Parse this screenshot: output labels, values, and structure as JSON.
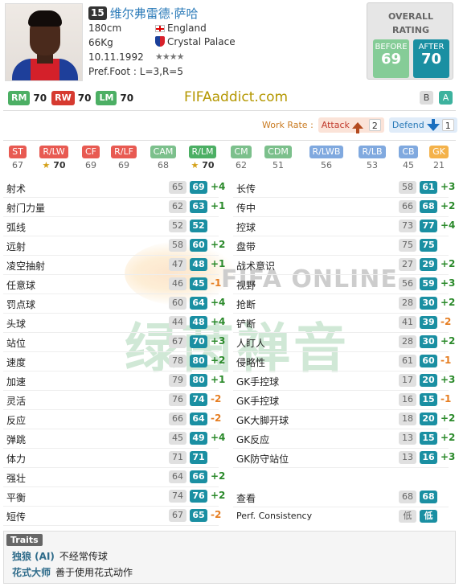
{
  "player": {
    "season_badge": "15",
    "name": "维尔弗雷德·萨哈",
    "height": "180cm",
    "weight": "66Kg",
    "birthdate": "10.11.1992",
    "nation": "England",
    "club": "Crystal Palace",
    "stars": "★★★★",
    "pref_foot": "Pref.Foot : L=3,R=5"
  },
  "overall": {
    "label": "OVERALL RATING",
    "before_label": "BEFORE",
    "before_value": "69",
    "after_label": "AFTER",
    "after_value": "70"
  },
  "main_positions": [
    {
      "pos": "RM",
      "value": "70",
      "color": "#4caf64"
    },
    {
      "pos": "RW",
      "value": "70",
      "color": "#e84a3e"
    },
    {
      "pos": "LM",
      "value": "70",
      "color": "#4caf64"
    }
  ],
  "brand": "FIFAaddict.com",
  "grades": [
    "B",
    "A"
  ],
  "work_rate": {
    "label": "Work Rate :",
    "attack_label": "Attack",
    "attack_value": "2",
    "defend_label": "Defend",
    "defend_value": "1"
  },
  "positions": [
    {
      "pos": "ST",
      "value": "67",
      "cls": "bg-red"
    },
    {
      "pos": "R/LW",
      "value": "70",
      "cls": "bg-red",
      "star": true
    },
    {
      "pos": "CF",
      "value": "69",
      "cls": "bg-red"
    },
    {
      "pos": "R/LF",
      "value": "69",
      "cls": "bg-red"
    },
    {
      "pos": "CAM",
      "value": "68",
      "cls": "bg-green"
    },
    {
      "pos": "R/LM",
      "value": "70",
      "cls": "bg-green2",
      "star": true
    },
    {
      "pos": "CM",
      "value": "62",
      "cls": "bg-green"
    },
    {
      "pos": "CDM",
      "value": "51",
      "cls": "bg-green"
    },
    {
      "pos": "R/LWB",
      "value": "56",
      "cls": "bg-blue"
    },
    {
      "pos": "R/LB",
      "value": "53",
      "cls": "bg-blue"
    },
    {
      "pos": "CB",
      "value": "45",
      "cls": "bg-blue"
    },
    {
      "pos": "GK",
      "value": "21",
      "cls": "bg-orange"
    }
  ],
  "stats_left": [
    {
      "name": "射术",
      "before": "65",
      "after": "69",
      "diff": "+4"
    },
    {
      "name": "射门力量",
      "before": "62",
      "after": "63",
      "diff": "+1"
    },
    {
      "name": "弧线",
      "before": "52",
      "after": "52",
      "diff": ""
    },
    {
      "name": "远射",
      "before": "58",
      "after": "60",
      "diff": "+2"
    },
    {
      "name": "凌空抽射",
      "before": "47",
      "after": "48",
      "diff": "+1"
    },
    {
      "name": "任意球",
      "before": "46",
      "after": "45",
      "diff": "-1"
    },
    {
      "name": "罚点球",
      "before": "60",
      "after": "64",
      "diff": "+4"
    },
    {
      "name": "头球",
      "before": "44",
      "after": "48",
      "diff": "+4"
    },
    {
      "name": "站位",
      "before": "67",
      "after": "70",
      "diff": "+3"
    },
    {
      "name": "速度",
      "before": "78",
      "after": "80",
      "diff": "+2"
    },
    {
      "name": "加速",
      "before": "79",
      "after": "80",
      "diff": "+1"
    },
    {
      "name": "灵活",
      "before": "76",
      "after": "74",
      "diff": "-2"
    },
    {
      "name": "反应",
      "before": "66",
      "after": "64",
      "diff": "-2"
    },
    {
      "name": "弹跳",
      "before": "45",
      "after": "49",
      "diff": "+4"
    },
    {
      "name": "体力",
      "before": "71",
      "after": "71",
      "diff": ""
    },
    {
      "name": "强壮",
      "before": "64",
      "after": "66",
      "diff": "+2"
    },
    {
      "name": "平衡",
      "before": "74",
      "after": "76",
      "diff": "+2"
    },
    {
      "name": "短传",
      "before": "67",
      "after": "65",
      "diff": "-2"
    }
  ],
  "stats_right": [
    {
      "name": "长传",
      "before": "58",
      "after": "61",
      "diff": "+3"
    },
    {
      "name": "传中",
      "before": "66",
      "after": "68",
      "diff": "+2"
    },
    {
      "name": "控球",
      "before": "73",
      "after": "77",
      "diff": "+4"
    },
    {
      "name": "盘带",
      "before": "75",
      "after": "75",
      "diff": ""
    },
    {
      "name": "战术意识",
      "before": "27",
      "after": "29",
      "diff": "+2"
    },
    {
      "name": "视野",
      "before": "56",
      "after": "59",
      "diff": "+3"
    },
    {
      "name": "抢断",
      "before": "28",
      "after": "30",
      "diff": "+2"
    },
    {
      "name": "铲断",
      "before": "41",
      "after": "39",
      "diff": "-2"
    },
    {
      "name": "人盯人",
      "before": "28",
      "after": "30",
      "diff": "+2"
    },
    {
      "name": "侵略性",
      "before": "61",
      "after": "60",
      "diff": "-1"
    },
    {
      "name": "GK手控球",
      "before": "17",
      "after": "20",
      "diff": "+3"
    },
    {
      "name": "GK手控球",
      "before": "16",
      "after": "15",
      "diff": "-1"
    },
    {
      "name": "GK大脚开球",
      "before": "18",
      "after": "20",
      "diff": "+2"
    },
    {
      "name": "GK反应",
      "before": "13",
      "after": "15",
      "diff": "+2"
    },
    {
      "name": "GK防守站位",
      "before": "13",
      "after": "16",
      "diff": "+3"
    }
  ],
  "extra": {
    "vision_label": "查看",
    "vision_before": "68",
    "vision_after": "68",
    "consistency_label": "Perf. Consistency",
    "consistency_before": "低",
    "consistency_after": "低"
  },
  "watermark": {
    "line1": "FIFA ONLINE",
    "line2": "绿茵禅音"
  },
  "traits": {
    "header": "Traits",
    "items": [
      {
        "name": "独狼 (AI)",
        "desc": "不经常传球"
      },
      {
        "name": "花式大师",
        "desc": "善于使用花式动作"
      }
    ]
  }
}
